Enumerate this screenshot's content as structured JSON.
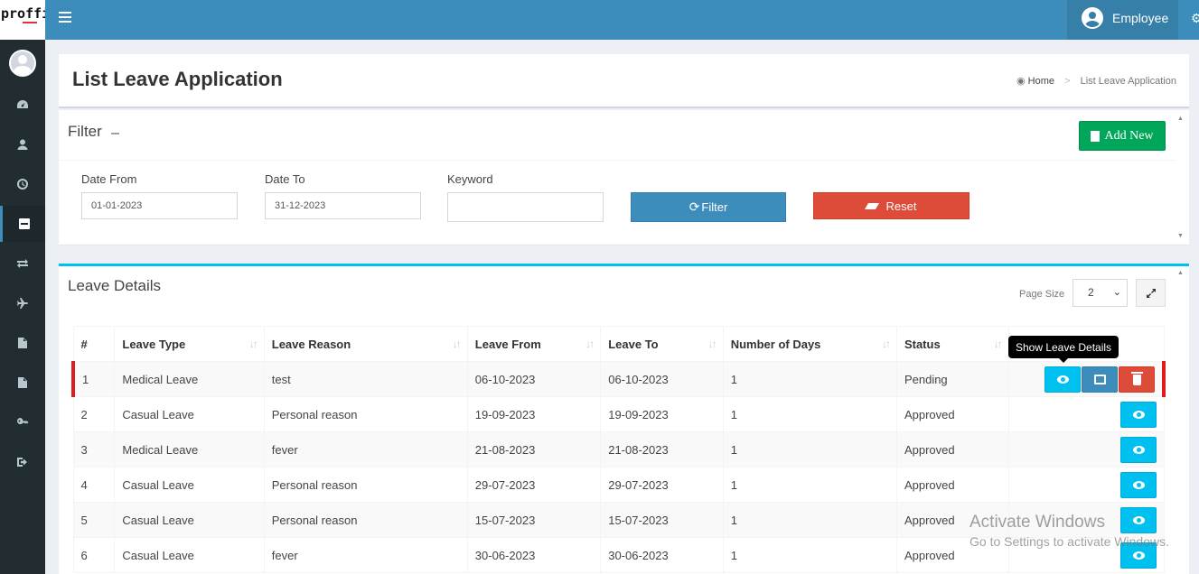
{
  "app": {
    "logo_text": "proffin"
  },
  "topbar": {
    "user_name": "Employee"
  },
  "sidebar": {
    "items": [
      {
        "name": "dashboard",
        "icon": "dashboard-icon",
        "active": false
      },
      {
        "name": "profile",
        "icon": "user-icon",
        "active": false
      },
      {
        "name": "attendance",
        "icon": "clock-icon",
        "active": false
      },
      {
        "name": "leave",
        "icon": "minus-square-icon",
        "active": true
      },
      {
        "name": "transfer",
        "icon": "exchange-icon",
        "active": false
      },
      {
        "name": "travel",
        "icon": "plane-icon",
        "active": false
      },
      {
        "name": "documents",
        "icon": "file-icon",
        "active": false
      },
      {
        "name": "reports",
        "icon": "file-text-icon",
        "active": false
      },
      {
        "name": "password",
        "icon": "key-icon",
        "active": false
      },
      {
        "name": "logout",
        "icon": "sign-out-icon",
        "active": false
      }
    ]
  },
  "header": {
    "title": "List Leave Application",
    "breadcrumb": {
      "home": "Home",
      "current": "List Leave Application"
    }
  },
  "filter": {
    "title": "Filter",
    "add_new_label": "Add New",
    "date_from_label": "Date From",
    "date_from_value": "01-01-2023",
    "date_to_label": "Date To",
    "date_to_value": "31-12-2023",
    "keyword_label": "Keyword",
    "keyword_value": "",
    "filter_label": "Filter",
    "reset_label": "Reset"
  },
  "details": {
    "title": "Leave Details",
    "page_size_label": "Page Size",
    "page_size_value": "2",
    "columns": [
      "#",
      "Leave Type",
      "Leave Reason",
      "Leave From",
      "Leave To",
      "Number of Days",
      "Status"
    ],
    "rows": [
      {
        "no": "1",
        "type": "Medical Leave",
        "reason": "test",
        "from": "06-10-2023",
        "to": "06-10-2023",
        "days": "1",
        "status": "Pending"
      },
      {
        "no": "2",
        "type": "Casual Leave",
        "reason": "Personal reason",
        "from": "19-09-2023",
        "to": "19-09-2023",
        "days": "1",
        "status": "Approved"
      },
      {
        "no": "3",
        "type": "Medical Leave",
        "reason": "fever",
        "from": "21-08-2023",
        "to": "21-08-2023",
        "days": "1",
        "status": "Approved"
      },
      {
        "no": "4",
        "type": "Casual Leave",
        "reason": "Personal reason",
        "from": "29-07-2023",
        "to": "29-07-2023",
        "days": "1",
        "status": "Approved"
      },
      {
        "no": "5",
        "type": "Casual Leave",
        "reason": "Personal reason",
        "from": "15-07-2023",
        "to": "15-07-2023",
        "days": "1",
        "status": "Approved"
      },
      {
        "no": "6",
        "type": "Casual Leave",
        "reason": "fever",
        "from": "30-06-2023",
        "to": "30-06-2023",
        "days": "1",
        "status": "Approved"
      }
    ],
    "tooltip": "Show Leave Details"
  },
  "watermark": {
    "line1": "Activate Windows",
    "line2": "Go to Settings to activate Windows."
  },
  "colors": {
    "topbar": "#3c8dbc",
    "sidebar": "#222d32",
    "success": "#00a65a",
    "danger": "#dd4b39",
    "info": "#00c0ef",
    "primary": "#3c8dbc"
  }
}
